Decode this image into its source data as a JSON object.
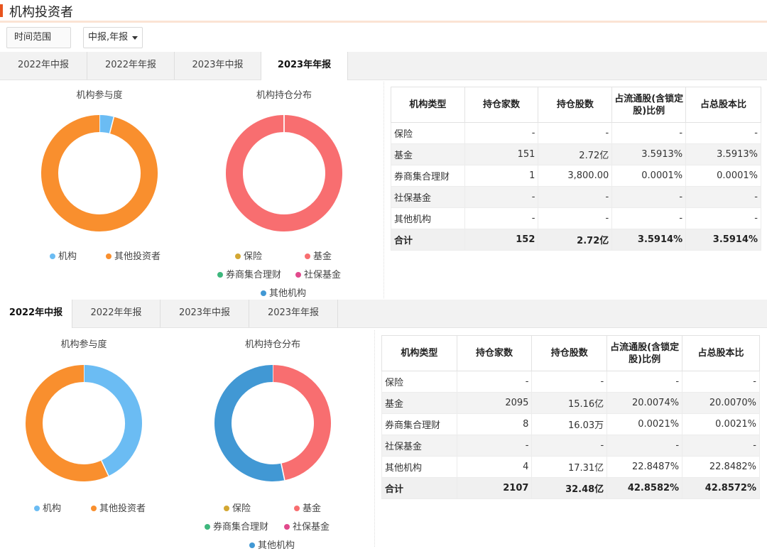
{
  "header": {
    "title": "机构投资者"
  },
  "controls": {
    "time_range_label": "时间范围",
    "report_select_value": "中报,年报"
  },
  "tabs": [
    "2022年中报",
    "2022年年报",
    "2023年中报",
    "2023年年报"
  ],
  "section1": {
    "active_tab": 3,
    "participation_title": "机构参与度",
    "distribution_title": "机构持仓分布",
    "participation": {
      "机构": 0.04,
      "其他投资者": 0.96
    },
    "distribution": {
      "保险": 0,
      "基金": 0.9999,
      "券商集合理财": 0.0001,
      "社保基金": 0,
      "其他机构": 0
    },
    "table": {
      "headers": [
        "机构类型",
        "持仓家数",
        "持仓股数",
        "占流通股(含锁定股)比例",
        "占总股本比"
      ],
      "rows": [
        [
          "保险",
          "-",
          "-",
          "-",
          "-"
        ],
        [
          "基金",
          "151",
          "2.72亿",
          "3.5913%",
          "3.5913%"
        ],
        [
          "券商集合理财",
          "1",
          "3,800.00",
          "0.0001%",
          "0.0001%"
        ],
        [
          "社保基金",
          "-",
          "-",
          "-",
          "-"
        ],
        [
          "其他机构",
          "-",
          "-",
          "-",
          "-"
        ]
      ],
      "total": [
        "合计",
        "152",
        "2.72亿",
        "3.5914%",
        "3.5914%"
      ]
    }
  },
  "section2": {
    "active_tab": 0,
    "participation_title": "机构参与度",
    "distribution_title": "机构持仓分布",
    "participation": {
      "机构": 0.43,
      "其他投资者": 0.57
    },
    "distribution": {
      "保险": 0,
      "基金": 0.4671,
      "券商集合理财": 0.0001,
      "社保基金": 0,
      "其他机构": 0.5328
    },
    "table": {
      "headers": [
        "机构类型",
        "持仓家数",
        "持仓股数",
        "占流通股(含锁定股)比例",
        "占总股本比"
      ],
      "rows": [
        [
          "保险",
          "-",
          "-",
          "-",
          "-"
        ],
        [
          "基金",
          "2095",
          "15.16亿",
          "20.0074%",
          "20.0070%"
        ],
        [
          "券商集合理财",
          "8",
          "16.03万",
          "0.0021%",
          "0.0021%"
        ],
        [
          "社保基金",
          "-",
          "-",
          "-",
          "-"
        ],
        [
          "其他机构",
          "4",
          "17.31亿",
          "22.8487%",
          "22.8482%"
        ]
      ],
      "total": [
        "合计",
        "2107",
        "32.48亿",
        "42.8582%",
        "42.8572%"
      ]
    }
  },
  "legend": {
    "participation": [
      "机构",
      "其他投资者"
    ],
    "distribution": [
      "保险",
      "基金",
      "券商集合理财",
      "社保基金",
      "其他机构"
    ]
  },
  "colors": {
    "机构": "#6bbcf3",
    "其他投资者": "#f98f2e",
    "保险": "#d3a733",
    "基金": "#f86e70",
    "券商集合理财": "#3eb77d",
    "社保基金": "#e1498c",
    "其他机构": "#4198d4",
    "accent": "#e8541e"
  }
}
